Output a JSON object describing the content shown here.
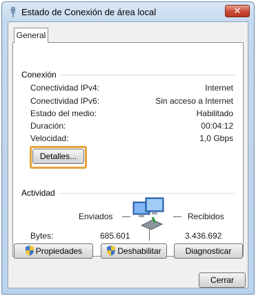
{
  "window": {
    "title": "Estado de Conexión de área local",
    "close_label": "✕"
  },
  "tabs": [
    {
      "label": "General",
      "selected": true
    }
  ],
  "connection": {
    "group_label": "Conexión",
    "rows": [
      {
        "label": "Conectividad IPv4:",
        "value": "Internet"
      },
      {
        "label": "Conectividad IPv6:",
        "value": "Sin acceso a Internet"
      },
      {
        "label": "Estado del medio:",
        "value": "Habilitado"
      },
      {
        "label": "Duración:",
        "value": "00:04:12"
      },
      {
        "label": "Velocidad:",
        "value": "1,0 Gbps"
      }
    ],
    "details_button": "Detalles..."
  },
  "activity": {
    "group_label": "Actividad",
    "sent_label": "Enviados",
    "received_label": "Recibidos",
    "bytes_label": "Bytes:",
    "bytes_sent": "685.601",
    "bytes_received": "3.436.692"
  },
  "buttons": {
    "properties": "Propiedades",
    "disable": "Deshabilitar",
    "diagnose": "Diagnosticar",
    "close": "Cerrar"
  },
  "icons": {
    "title": "network-connection-icon",
    "activity": "network-computers-icon",
    "shield": "uac-shield-icon"
  },
  "colors": {
    "highlight": "#e3a33b",
    "close_button": "#c74a36"
  }
}
